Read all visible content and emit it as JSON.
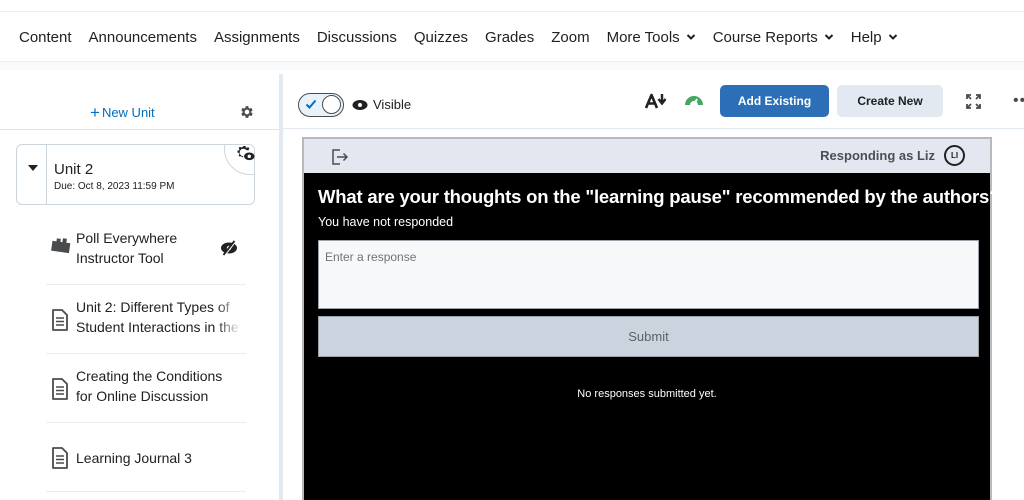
{
  "nav": {
    "items": [
      {
        "label": "Content",
        "dropdown": false
      },
      {
        "label": "Announcements",
        "dropdown": false
      },
      {
        "label": "Assignments",
        "dropdown": false
      },
      {
        "label": "Discussions",
        "dropdown": false
      },
      {
        "label": "Quizzes",
        "dropdown": false
      },
      {
        "label": "Grades",
        "dropdown": false
      },
      {
        "label": "Zoom",
        "dropdown": false
      },
      {
        "label": "More Tools",
        "dropdown": true
      },
      {
        "label": "Course Reports",
        "dropdown": true
      },
      {
        "label": "Help",
        "dropdown": true
      }
    ]
  },
  "sidebar": {
    "new_unit_label": "New Unit",
    "unit": {
      "title": "Unit 2",
      "due": "Due: Oct 8, 2023 11:59 PM"
    },
    "items": [
      {
        "line1": "Poll Everywhere",
        "line2": "Instructor Tool",
        "icon": "plugin-icon",
        "hidden": true
      },
      {
        "line1": "Unit 2: Different Types of",
        "line2": "Student Interactions in the",
        "icon": "document-icon",
        "hidden": false
      },
      {
        "line1": "Creating the Conditions",
        "line2": "for Online Discussion",
        "icon": "document-icon",
        "hidden": false
      },
      {
        "line1": "Learning Journal 3",
        "line2": "",
        "icon": "document-icon",
        "hidden": false
      }
    ]
  },
  "toolbar": {
    "visibility_label": "Visible",
    "visibility_on": true,
    "add_existing_label": "Add Existing",
    "create_new_label": "Create New",
    "more_label": "•••",
    "colors": {
      "primary": "#2c6fb7",
      "gauge": "#46a661"
    }
  },
  "poll": {
    "responding_as": "Responding as Liz",
    "avatar_initials": "LI",
    "question": "What are your thoughts on the \"learning pause\" recommended by the authors?",
    "status": "You have not responded",
    "input_placeholder": "Enter a response",
    "input_value": "",
    "submit_label": "Submit",
    "empty_message": "No responses submitted yet."
  }
}
